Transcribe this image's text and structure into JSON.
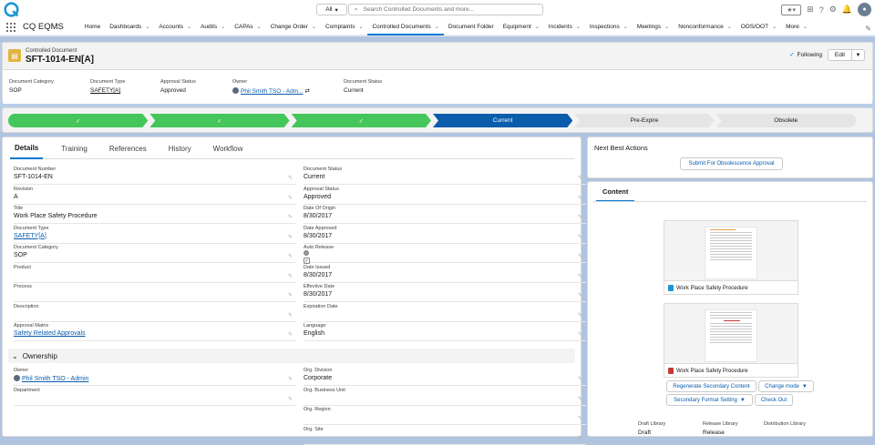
{
  "app": {
    "name": "CQ EQMS",
    "search_scope": "All",
    "search_placeholder": "Search Controlled Documents and more...",
    "brand_color": "#0176d3"
  },
  "nav": {
    "items": [
      {
        "label": "Home",
        "has_menu": false
      },
      {
        "label": "Dashboards",
        "has_menu": true
      },
      {
        "label": "Accounts",
        "has_menu": true
      },
      {
        "label": "Audits",
        "has_menu": true
      },
      {
        "label": "CAPAs",
        "has_menu": true
      },
      {
        "label": "Change Order",
        "has_menu": true
      },
      {
        "label": "Complaints",
        "has_menu": true
      },
      {
        "label": "Controlled Documents",
        "has_menu": true,
        "active": true
      },
      {
        "label": "Document Folder",
        "has_menu": false
      },
      {
        "label": "Equipment",
        "has_menu": true
      },
      {
        "label": "Incidents",
        "has_menu": true
      },
      {
        "label": "Inspections",
        "has_menu": true
      },
      {
        "label": "Meetings",
        "has_menu": true
      },
      {
        "label": "Nonconformance",
        "has_menu": true
      },
      {
        "label": "OOS/OOT",
        "has_menu": true
      },
      {
        "label": "More",
        "has_menu": true
      }
    ]
  },
  "record": {
    "type_label": "Controlled Document",
    "name": "SFT-1014-EN[A]",
    "follow_label": "Following",
    "edit_label": "Edit",
    "highlights": [
      {
        "label": "Document Category",
        "value": "SOP"
      },
      {
        "label": "Document Type",
        "value": "SAFETY[A]"
      },
      {
        "label": "Approval Status",
        "value": "Approved"
      },
      {
        "label": "Owner",
        "value": "Phil Smith TSO - Adm..."
      },
      {
        "label": "Document Status",
        "value": "Current"
      }
    ]
  },
  "path": {
    "steps": [
      {
        "label": "✓",
        "state": "done"
      },
      {
        "label": "✓",
        "state": "done"
      },
      {
        "label": "✓",
        "state": "done"
      },
      {
        "label": "Current",
        "state": "cur"
      },
      {
        "label": "Pre-Expire",
        "state": "todo"
      },
      {
        "label": "Obsolete",
        "state": "todo"
      }
    ]
  },
  "tabs": [
    "Details",
    "Training",
    "References",
    "History",
    "Workflow"
  ],
  "details": {
    "left": [
      {
        "label": "Document Number",
        "value": "SFT-1014-EN"
      },
      {
        "label": "Revision",
        "value": "A"
      },
      {
        "label": "Title",
        "value": "Work Place Safety Procedure"
      },
      {
        "label": "Document Type",
        "value": "SAFETY[A]"
      },
      {
        "label": "Document Category",
        "value": "SOP"
      },
      {
        "label": "Product",
        "value": ""
      },
      {
        "label": "Process",
        "value": ""
      },
      {
        "label": "Description",
        "value": ""
      },
      {
        "label": "Approval Matrix",
        "value": "Safety Related Approvals"
      }
    ],
    "right": [
      {
        "label": "Document Status",
        "value": "Current"
      },
      {
        "label": "Approval Status",
        "value": "Approved"
      },
      {
        "label": "Date Of Origin",
        "value": "8/30/2017"
      },
      {
        "label": "Date Approved",
        "value": "8/30/2017"
      },
      {
        "label": "Auto Release",
        "value": "✓"
      },
      {
        "label": "Date Issued",
        "value": "8/30/2017"
      },
      {
        "label": "Effective Date",
        "value": "8/30/2017"
      },
      {
        "label": "Expiration Date",
        "value": ""
      },
      {
        "label": "Language",
        "value": "English"
      }
    ]
  },
  "ownership": {
    "title": "Ownership",
    "left": [
      {
        "label": "Owner",
        "value": "Phil Smith TSO - Admin"
      },
      {
        "label": "Department",
        "value": ""
      }
    ],
    "right": [
      {
        "label": "Org. Division",
        "value": "Corporate"
      },
      {
        "label": "Org. Business Unit",
        "value": ""
      },
      {
        "label": "Org. Region",
        "value": ""
      },
      {
        "label": "Org. Site",
        "value": ""
      }
    ]
  },
  "nba": {
    "title": "Next Best Actions",
    "action": "Submit For Obsolescence Approval"
  },
  "content": {
    "tab": "Content",
    "files": [
      {
        "name": "Work Place Safety Procedure",
        "icon_color": "#1b96d3"
      },
      {
        "name": "Work Place Safety Procedure",
        "icon_color": "#c23934"
      }
    ],
    "buttons": {
      "regenerate": "Regenerate Secondary Content",
      "change_mode": "Change mode",
      "format": "Secondary Format Setting",
      "checkout": "Check Out"
    },
    "libraries": [
      {
        "label": "Draft Library",
        "value": "Draft"
      },
      {
        "label": "Release Library",
        "value": "Release"
      },
      {
        "label": "Distribution Library",
        "value": ""
      }
    ]
  }
}
